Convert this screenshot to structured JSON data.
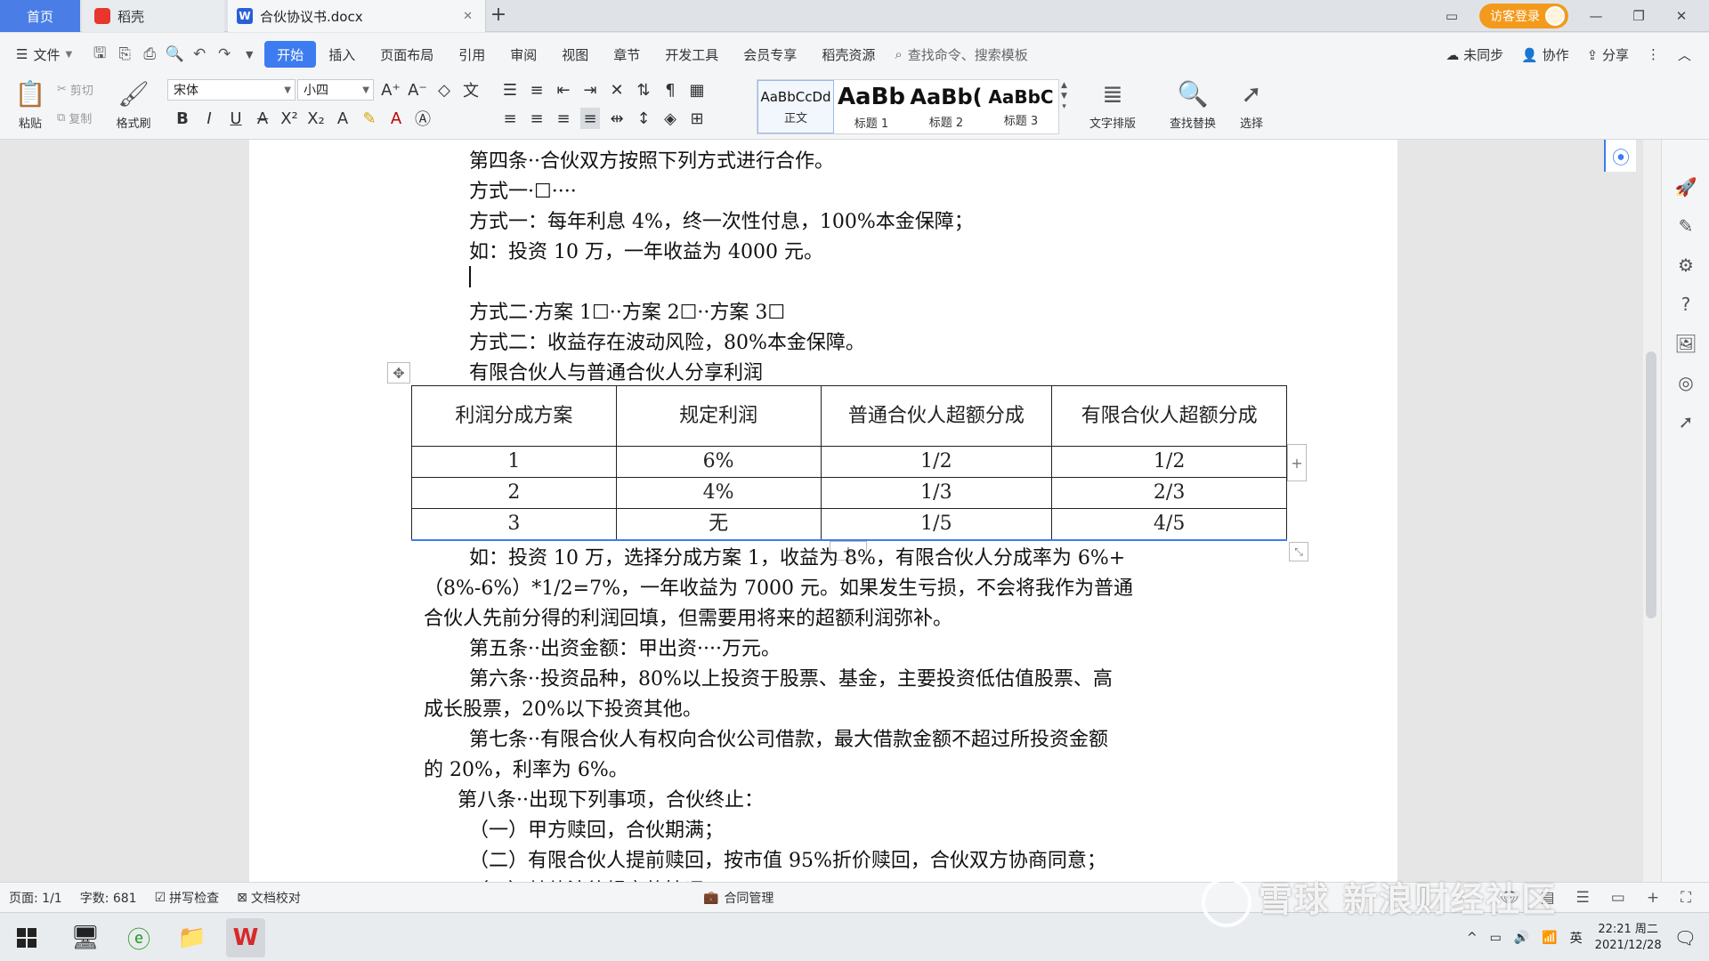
{
  "tabs": {
    "home": "首页",
    "docer": "稻壳",
    "document": "合伙协议书.docx"
  },
  "window": {
    "login_label": "访客登录"
  },
  "menu": {
    "file": "文件",
    "tabs": [
      "开始",
      "插入",
      "页面布局",
      "引用",
      "审阅",
      "视图",
      "章节",
      "开发工具",
      "会员专享",
      "稻壳资源"
    ],
    "search_placeholder": "查找命令、搜索模板",
    "sync": "未同步",
    "collab": "协作",
    "share": "分享"
  },
  "toolbar": {
    "paste": "粘贴",
    "cut": "剪切",
    "copy": "复制",
    "format_painter": "格式刷",
    "font_name": "宋体",
    "font_size": "小四",
    "styles": [
      {
        "sample": "AaBbCcDd",
        "name": "正文"
      },
      {
        "sample": "AaBb",
        "name": "标题 1"
      },
      {
        "sample": "AaBb(",
        "name": "标题 2"
      },
      {
        "sample": "AaBbC",
        "name": "标题 3"
      }
    ],
    "text_layout": "文字排版",
    "find_replace": "查找替换",
    "select": "选择"
  },
  "document": {
    "p1": "第四条··合伙双方按照下列方式进行合作。",
    "p2": "方式一·☐····",
    "p3": "方式一：每年利息 4%，终一次性付息，100%本金保障；",
    "p4": "如：投资 10 万，一年收益为 4000 元。",
    "p5": "方式二·方案 1☐··方案 2☐··方案 3☐",
    "p6": "方式二：收益存在波动风险，80%本金保障。",
    "p7": "有限合伙人与普通合伙人分享利润",
    "table": {
      "headers": [
        "利润分成方案",
        "规定利润",
        "普通合伙人超额分成",
        "有限合伙人超额分成"
      ],
      "rows": [
        [
          "1",
          "6%",
          "1/2",
          "1/2"
        ],
        [
          "2",
          "4%",
          "1/3",
          "2/3"
        ],
        [
          "3",
          "无",
          "1/5",
          "4/5"
        ]
      ]
    },
    "p8a": "如：投资 10 万，选择分成方案 1，收益为 8%，有限合伙人分成率为 6%+",
    "p8b": "（8%-6%）*1/2=7%，一年收益为 7000 元。如果发生亏损，不会将我作为普通",
    "p8c": "合伙人先前分得的利润回填，但需要用将来的超额利润弥补。",
    "p9": "第五条··出资金额：甲出资····万元。",
    "p10a": "第六条··投资品种，80%以上投资于股票、基金，主要投资低估值股票、高",
    "p10b": "成长股票，20%以下投资其他。",
    "p11a": "第七条··有限合伙人有权向合伙公司借款，最大借款金额不超过所投资金额",
    "p11b": "的 20%，利率为 6%。",
    "p12": "第八条··出现下列事项，合伙终止：",
    "p13": "（一）甲方赎回，合伙期满；",
    "p14": "（二）有限合伙人提前赎回，按市值 95%折价赎回，合伙双方协商同意；",
    "p15": "（三）其他法律规定的情况"
  },
  "status": {
    "page": "页面: 1/1",
    "words": "字数: 681",
    "spell": "拼写检查",
    "proof": "文档校对",
    "contract": "合同管理"
  },
  "tray": {
    "ime": "英",
    "time": "22:21 周二",
    "date": "2021/12/28"
  },
  "watermark": "雪球 新浪财经社区"
}
